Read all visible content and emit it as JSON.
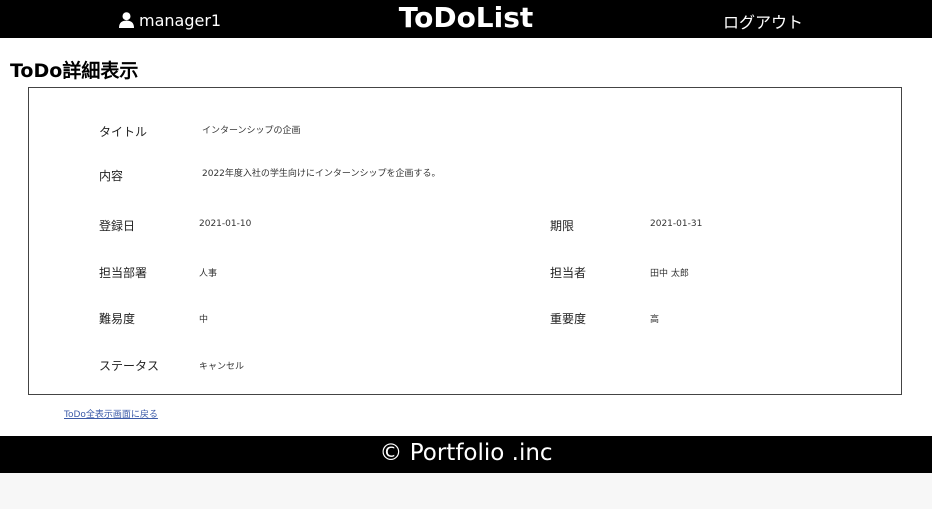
{
  "header": {
    "username": "manager1",
    "brand": "ToDoList",
    "logout_label": "ログアウト"
  },
  "page": {
    "title": "ToDo詳細表示"
  },
  "detail": {
    "title_label": "タイトル",
    "title_value": "インターンシップの企画",
    "content_label": "内容",
    "content_value": "2022年度入社の学生向けにインターンシップを企画する。",
    "created_label": "登録日",
    "created_value": "2021-01-10",
    "deadline_label": "期限",
    "deadline_value": "2021-01-31",
    "department_label": "担当部署",
    "department_value": "人事",
    "assignee_label": "担当者",
    "assignee_value": "田中 太郎",
    "difficulty_label": "難易度",
    "difficulty_value": "中",
    "importance_label": "重要度",
    "importance_value": "高",
    "status_label": "ステータス",
    "status_value": "キャンセル"
  },
  "links": {
    "back_label": "ToDo全表示画面に戻る"
  },
  "footer": {
    "copyright": "© Portfolio .inc"
  },
  "icons": {
    "user": "user-icon"
  },
  "colors": {
    "header_bg": "#000000",
    "footer_bg": "#000000",
    "link": "#3b5aa8",
    "box_border": "#444444"
  }
}
